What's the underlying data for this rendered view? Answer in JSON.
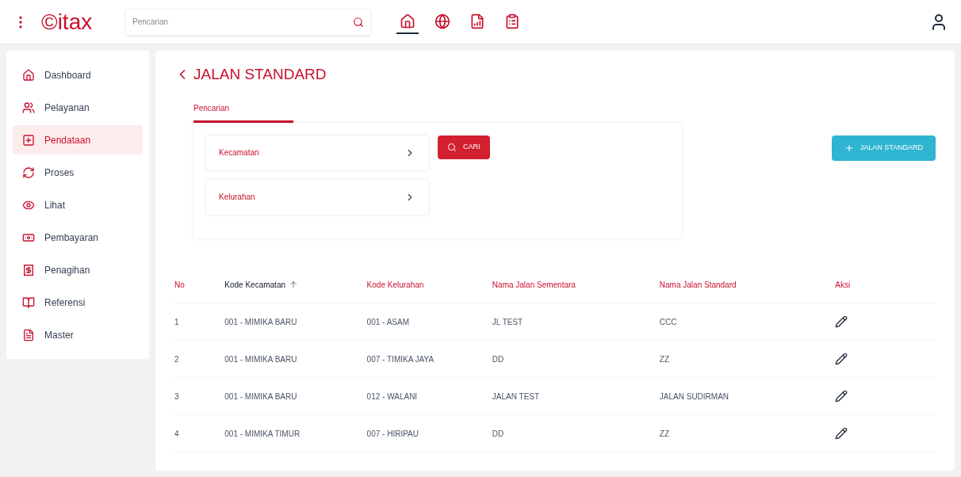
{
  "header": {
    "logo": "©itax",
    "search": {
      "placeholder": "Pencarian"
    },
    "nav": [
      {
        "kind": "home",
        "selected": true
      },
      {
        "kind": "globe",
        "selected": false
      },
      {
        "kind": "report",
        "selected": false
      },
      {
        "kind": "form",
        "selected": false
      }
    ]
  },
  "sidebar": {
    "items": [
      {
        "kind": "home",
        "label": "Dashboard",
        "selected": false
      },
      {
        "kind": "users",
        "label": "Pelayanan",
        "selected": false
      },
      {
        "kind": "plus",
        "label": "Pendataan",
        "selected": true
      },
      {
        "kind": "cycle",
        "label": "Proses",
        "selected": false
      },
      {
        "kind": "eye",
        "label": "Lihat",
        "selected": false
      },
      {
        "kind": "money",
        "label": "Pembayaran",
        "selected": false
      },
      {
        "kind": "bill",
        "label": "Penagihan",
        "selected": false
      },
      {
        "kind": "book",
        "label": "Referensi",
        "selected": false
      },
      {
        "kind": "file",
        "label": "Master",
        "selected": false
      }
    ]
  },
  "page": {
    "title": "JALAN STANDARD",
    "tabs": [
      {
        "label": "Pencarian",
        "selected": true
      }
    ],
    "filters": [
      "Kecamatan",
      "Kelurahan"
    ],
    "search_button": "CARI",
    "add_button": "JALAN STANDARD"
  },
  "table": {
    "columns": [
      {
        "label": "No",
        "sorted": false
      },
      {
        "label": "Kode Kecamatan",
        "sorted": true
      },
      {
        "label": "Kode Kelurahan",
        "sorted": false
      },
      {
        "label": "Nama Jalan Sementara",
        "sorted": false
      },
      {
        "label": "Nama Jalan Standard",
        "sorted": false
      },
      {
        "label": "Aksi",
        "sorted": false
      }
    ],
    "rows": [
      [
        "1",
        "001 - MIMIKA BARU",
        "001 - ASAM",
        "JL TEST",
        "CCC"
      ],
      [
        "2",
        "001 - MIMIKA BARU",
        "007 - TIMIKA JAYA",
        "DD",
        "ZZ"
      ],
      [
        "3",
        "001 - MIMIKA BARU",
        "012 - WALANI",
        "JALAN TEST",
        "JALAN SUDIRMAN"
      ],
      [
        "4",
        "001 - MIMIKA TIMUR",
        "007 - HIRIPAU",
        "DD",
        "ZZ"
      ]
    ]
  }
}
